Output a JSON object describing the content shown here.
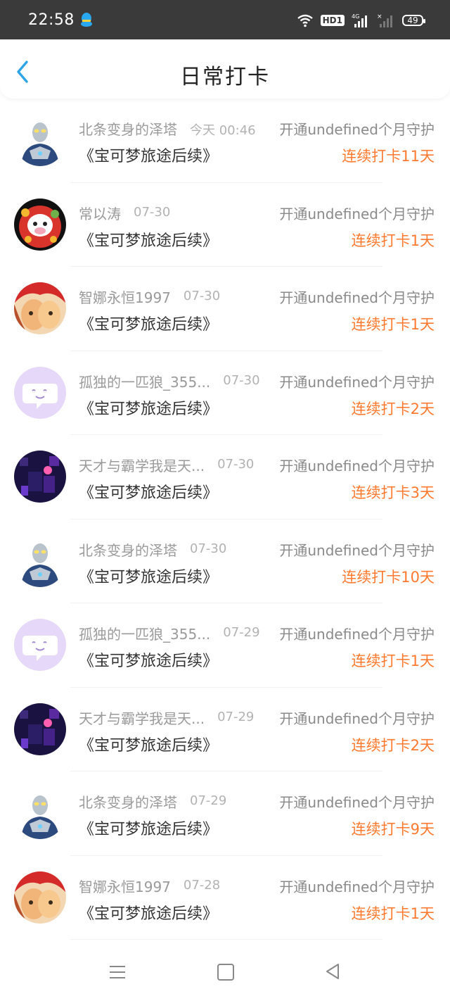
{
  "status_bar": {
    "time": "22:58",
    "hd_label": "HD1",
    "battery": "49",
    "icons": [
      "qq-penguin-icon",
      "wifi-icon",
      "signal-4g-icon",
      "signal-icon",
      "battery-icon"
    ]
  },
  "header": {
    "title": "日常打卡",
    "back_icon": "chevron-left-icon"
  },
  "entries": [
    {
      "name": "北条变身的泽塔",
      "date": "今天 00:46",
      "guard": "开通undefined个月守护",
      "show": "《宝可梦旅途后续》",
      "streak": "连续打卡11天",
      "avatar": "ultraman"
    },
    {
      "name": "常以涛",
      "date": "07-30",
      "guard": "开通undefined个月守护",
      "show": "《宝可梦旅途后续》",
      "streak": "连续打卡1天",
      "avatar": "cow"
    },
    {
      "name": "智娜永恒1997",
      "date": "07-30",
      "guard": "开通undefined个月守护",
      "show": "《宝可梦旅途后续》",
      "streak": "连续打卡1天",
      "avatar": "anime"
    },
    {
      "name": "孤独的一匹狼_355...",
      "date": "07-30",
      "guard": "开通undefined个月守护",
      "show": "《宝可梦旅途后续》",
      "streak": "连续打卡2天",
      "avatar": "chat"
    },
    {
      "name": "天才与霸学我是天...",
      "date": "07-30",
      "guard": "开通undefined个月守护",
      "show": "《宝可梦旅途后续》",
      "streak": "连续打卡3天",
      "avatar": "dark"
    },
    {
      "name": "北条变身的泽塔",
      "date": "07-30",
      "guard": "开通undefined个月守护",
      "show": "《宝可梦旅途后续》",
      "streak": "连续打卡10天",
      "avatar": "ultraman"
    },
    {
      "name": "孤独的一匹狼_355...",
      "date": "07-29",
      "guard": "开通undefined个月守护",
      "show": "《宝可梦旅途后续》",
      "streak": "连续打卡1天",
      "avatar": "chat"
    },
    {
      "name": "天才与霸学我是天...",
      "date": "07-29",
      "guard": "开通undefined个月守护",
      "show": "《宝可梦旅途后续》",
      "streak": "连续打卡2天",
      "avatar": "dark"
    },
    {
      "name": "北条变身的泽塔",
      "date": "07-29",
      "guard": "开通undefined个月守护",
      "show": "《宝可梦旅途后续》",
      "streak": "连续打卡9天",
      "avatar": "ultraman"
    },
    {
      "name": "智娜永恒1997",
      "date": "07-28",
      "guard": "开通undefined个月守护",
      "show": "《宝可梦旅途后续》",
      "streak": "连续打卡1天",
      "avatar": "anime"
    }
  ],
  "nav_bar": {
    "icons": [
      "menu-icon",
      "home-square-icon",
      "back-triangle-icon"
    ]
  },
  "colors": {
    "status_bar_bg": "#3a3a3a",
    "accent_blue": "#2fa5e8",
    "streak_orange": "#ff7a2e",
    "name_gray": "#9a9a9a"
  }
}
